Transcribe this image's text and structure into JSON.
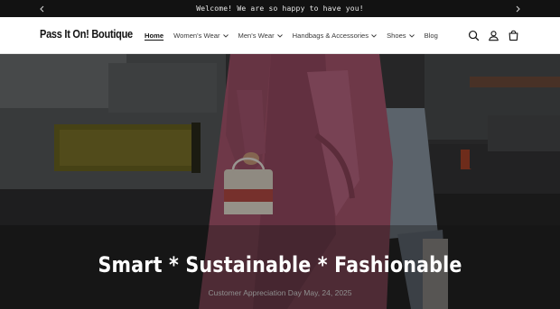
{
  "announcement": {
    "text": "Welcome! We are so happy to have you!",
    "prev_icon": "chevron-left-icon",
    "next_icon": "chevron-right-icon"
  },
  "header": {
    "logo": "Pass It On! Boutique",
    "nav": [
      {
        "label": "Home",
        "active": true,
        "dropdown": false
      },
      {
        "label": "Women's Wear",
        "active": false,
        "dropdown": true
      },
      {
        "label": "Men's Wear",
        "active": false,
        "dropdown": true
      },
      {
        "label": "Handbags & Accessories",
        "active": false,
        "dropdown": true
      },
      {
        "label": "Shoes",
        "active": false,
        "dropdown": true
      },
      {
        "label": "Blog",
        "active": false,
        "dropdown": false
      }
    ],
    "icons": [
      "search-icon",
      "account-icon",
      "cart-icon"
    ]
  },
  "hero": {
    "title": "Smart * Sustainable * Fashionable",
    "subtitle": "Customer Appreciation Day May, 24, 2025"
  },
  "colors": {
    "announcement_bg": "#121212",
    "header_bg": "#ffffff",
    "text_dark": "#121212",
    "coat_pink": "#a8566e"
  }
}
